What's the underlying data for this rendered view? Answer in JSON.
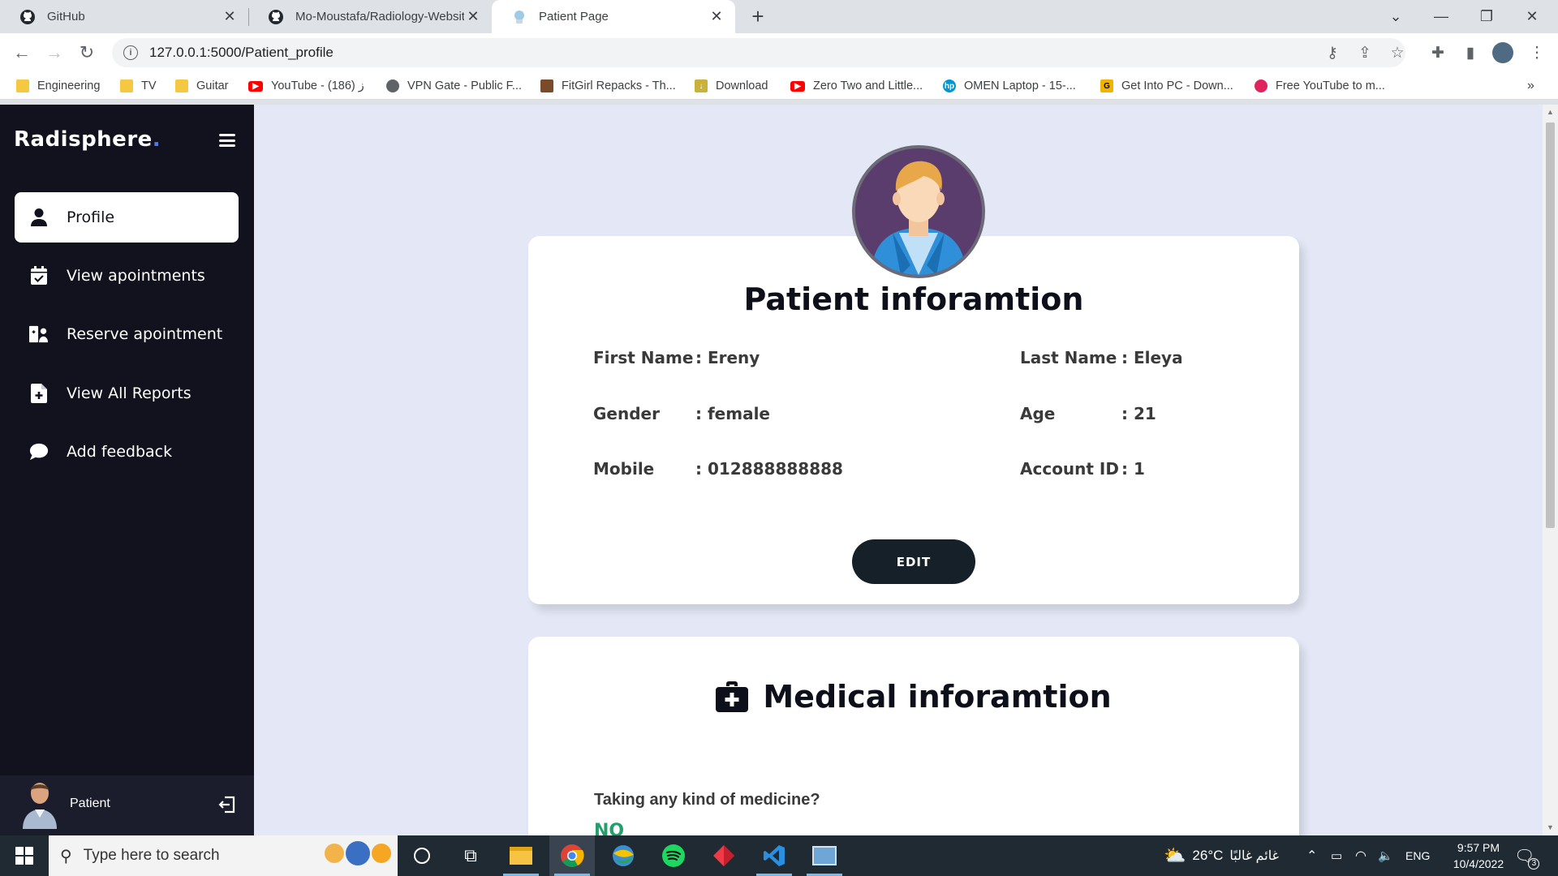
{
  "browser": {
    "tabs": [
      {
        "label": "GitHub",
        "icon": "github-icon"
      },
      {
        "label": "Mo-Moustafa/Radiology-Website",
        "icon": "github-icon"
      },
      {
        "label": "Patient Page",
        "icon": "site-icon"
      }
    ],
    "new_tab_label": "+",
    "url": "127.0.0.1:5000/Patient_profile",
    "bookmarks": [
      "Engineering",
      "TV",
      "Guitar",
      "YouTube - ز (186)",
      "VPN Gate - Public F...",
      "FitGirl Repacks - Th...",
      "Download",
      "Zero Two and Little...",
      "OMEN Laptop - 15-...",
      "Get Into PC - Down...",
      "Free YouTube to m..."
    ]
  },
  "sidebar": {
    "brand": "Radisphere",
    "brand_dot": ".",
    "items": [
      {
        "label": "Profile",
        "icon": "user-icon"
      },
      {
        "label": "View apointments",
        "icon": "calendar-check-icon"
      },
      {
        "label": "Reserve apointment",
        "icon": "user-medical-icon"
      },
      {
        "label": "View All Reports",
        "icon": "file-medical-icon"
      },
      {
        "label": "Add feedback",
        "icon": "comment-icon"
      }
    ],
    "footer": {
      "role": "Patient",
      "logout_icon": "logout-icon"
    }
  },
  "patient_card": {
    "title": "Patient inforamtion",
    "fields": {
      "first_name_label": "First Name",
      "first_name_value": ": Ereny",
      "last_name_label": "Last Name",
      "last_name_value": ": Eleya",
      "gender_label": "Gender",
      "gender_value": ": female",
      "age_label": "Age",
      "age_value": ": 21",
      "mobile_label": "Mobile",
      "mobile_value": ": 012888888888",
      "account_id_label": "Account ID",
      "account_id_value": ": 1"
    },
    "edit_label": "EDIT"
  },
  "medical_card": {
    "title": "Medical inforamtion",
    "title_icon": "medkit-icon",
    "question": "Taking any kind of medicine?",
    "answer": "NO",
    "answer_color": "#20a06a"
  },
  "taskbar": {
    "search_placeholder": "Type here to search",
    "weather": "26°C",
    "weather_text": "غائم غالبًا",
    "language": "ENG",
    "time": "9:57 PM",
    "date": "10/4/2022",
    "notifications": "3"
  }
}
